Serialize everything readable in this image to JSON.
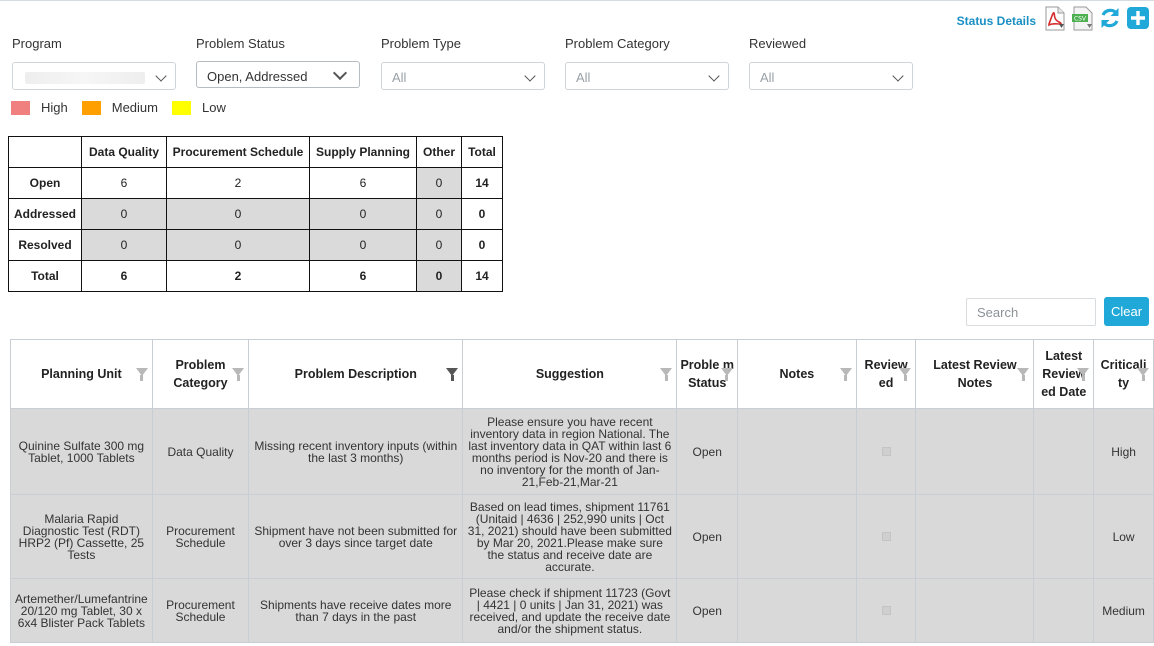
{
  "header": {
    "status_details_label": "Status Details",
    "icons": [
      "pdf-download-icon",
      "csv-download-icon",
      "refresh-icon",
      "add-icon"
    ]
  },
  "filters": {
    "program": {
      "label": "Program",
      "value": ""
    },
    "problem_status": {
      "label": "Problem Status",
      "value": "Open, Addressed"
    },
    "problem_type": {
      "label": "Problem Type",
      "value": "All"
    },
    "problem_category": {
      "label": "Problem Category",
      "value": "All"
    },
    "reviewed": {
      "label": "Reviewed",
      "value": "All"
    }
  },
  "legend": [
    {
      "label": "High",
      "color": "#f08080"
    },
    {
      "label": "Medium",
      "color": "#ff9f00"
    },
    {
      "label": "Low",
      "color": "#ffff00"
    }
  ],
  "summary": {
    "columns": [
      "",
      "Data Quality",
      "Procurement Schedule",
      "Supply Planning",
      "Other",
      "Total"
    ],
    "rows": [
      {
        "label": "Open",
        "values": [
          "6",
          "2",
          "6",
          "0",
          "14"
        ]
      },
      {
        "label": "Addressed",
        "values": [
          "0",
          "0",
          "0",
          "0",
          "0"
        ]
      },
      {
        "label": "Resolved",
        "values": [
          "0",
          "0",
          "0",
          "0",
          "0"
        ]
      },
      {
        "label": "Total",
        "values": [
          "6",
          "2",
          "6",
          "0",
          "14"
        ]
      }
    ]
  },
  "search": {
    "placeholder": "Search",
    "clear_label": "Clear"
  },
  "grid": {
    "columns": [
      "Planning Unit",
      "Problem Category",
      "Problem Description",
      "Suggestion",
      "Proble m Status",
      "Notes",
      "Review ed",
      "Latest Review Notes",
      "Latest Review ed Date",
      "Criticali ty"
    ],
    "rows": [
      {
        "planning_unit": "Quinine Sulfate 300 mg Tablet, 1000 Tablets",
        "category": "Data Quality",
        "description": "Missing recent inventory inputs (within the last 3 months)",
        "suggestion": "Please ensure you have recent inventory data in region National. The last inventory data in QAT within last 6 months period is  Nov-20 and there is no inventory for the month of Jan-21,Feb-21,Mar-21",
        "status": "Open",
        "notes": "",
        "latest_review_notes": "",
        "latest_reviewed_date": "",
        "criticality": "High"
      },
      {
        "planning_unit": "Malaria Rapid Diagnostic Test (RDT) HRP2 (Pf) Cassette, 25 Tests",
        "category": "Procurement Schedule",
        "description": "Shipment have not been submitted for over 3 days since target date",
        "suggestion": "Based on lead times, shipment 11761 (Unitaid | 4636 | 252,990 units | Oct 31, 2021) should have been submitted by Mar 20, 2021.Please make sure the status and receive date are accurate.",
        "status": "Open",
        "notes": "",
        "latest_review_notes": "",
        "latest_reviewed_date": "",
        "criticality": "Low"
      },
      {
        "planning_unit": "Artemether/Lumefantrine 20/120 mg Tablet, 30 x 6x4 Blister Pack Tablets",
        "category": "Procurement Schedule",
        "description": "Shipments have receive dates more than 7 days in the past",
        "suggestion": "Please check if shipment 11723 (Govt | 4421 | 0 units | Jan 31, 2021) was received, and update the receive date and/or the shipment status.",
        "status": "Open",
        "notes": "",
        "latest_review_notes": "",
        "latest_reviewed_date": "",
        "criticality": "Medium"
      }
    ]
  }
}
